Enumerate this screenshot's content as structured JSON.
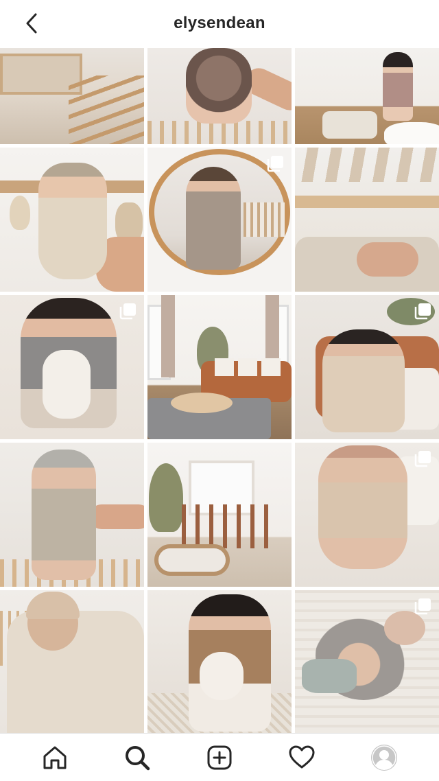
{
  "header": {
    "title": "elysendean",
    "back_icon": "chevron-left-icon"
  },
  "grid": {
    "posts": [
      {
        "id": 1,
        "multi": false
      },
      {
        "id": 2,
        "multi": false
      },
      {
        "id": 3,
        "multi": false
      },
      {
        "id": 4,
        "multi": false
      },
      {
        "id": 5,
        "multi": true
      },
      {
        "id": 6,
        "multi": false
      },
      {
        "id": 7,
        "multi": true
      },
      {
        "id": 8,
        "multi": false
      },
      {
        "id": 9,
        "multi": true
      },
      {
        "id": 10,
        "multi": false
      },
      {
        "id": 11,
        "multi": false
      },
      {
        "id": 12,
        "multi": true
      },
      {
        "id": 13,
        "multi": false
      },
      {
        "id": 14,
        "multi": false
      },
      {
        "id": 15,
        "multi": true
      }
    ]
  },
  "tabbar": {
    "items": [
      {
        "name": "home",
        "icon": "home-icon"
      },
      {
        "name": "search",
        "icon": "search-icon",
        "active": true
      },
      {
        "name": "new-post",
        "icon": "plus-square-icon"
      },
      {
        "name": "activity",
        "icon": "heart-icon"
      },
      {
        "name": "profile",
        "icon": "avatar-icon"
      }
    ]
  },
  "colors": {
    "text": "#262626",
    "background": "#ffffff",
    "divider": "#e5e5e5",
    "avatar_bg": "#c7c7c7"
  }
}
